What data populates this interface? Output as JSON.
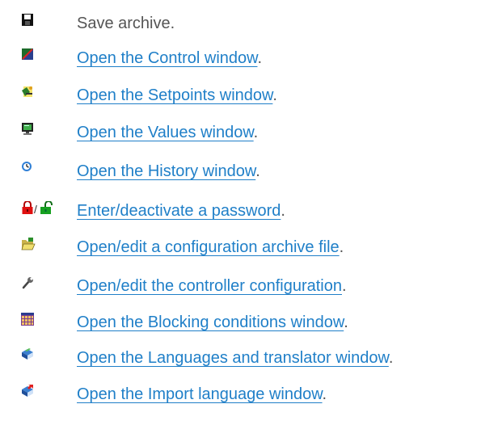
{
  "items": [
    {
      "icon": "floppy-disk-icon",
      "link": "",
      "rest": "Save archive."
    },
    {
      "icon": "control-window-icon",
      "link": "Open the Control window",
      "rest": "."
    },
    {
      "icon": "setpoints-window-icon",
      "link": "Open the Setpoints window",
      "rest": "."
    },
    {
      "icon": "monitor-icon",
      "link": "Open the Values window",
      "rest": "."
    },
    {
      "icon": "clock-icon",
      "link": "Open the History window",
      "rest": "."
    },
    {
      "icon": "padlock-icons",
      "separator": "/",
      "link": "Enter/deactivate a password",
      "rest": "."
    },
    {
      "icon": "open-folder-icon",
      "link": "Open/edit a configuration archive file",
      "rest": "."
    },
    {
      "icon": "wrench-icon",
      "link": "Open/edit the controller configuration",
      "rest": "."
    },
    {
      "icon": "calendar-grid-icon",
      "link": "Open the Blocking conditions window",
      "rest": "."
    },
    {
      "icon": "book-icon",
      "link": "Open the Languages and translator window",
      "rest": "."
    },
    {
      "icon": "book-import-icon",
      "link": "Open the Import language window",
      "rest": "."
    }
  ],
  "colors": {
    "link": "#1f7fc8",
    "text": "#555555"
  }
}
